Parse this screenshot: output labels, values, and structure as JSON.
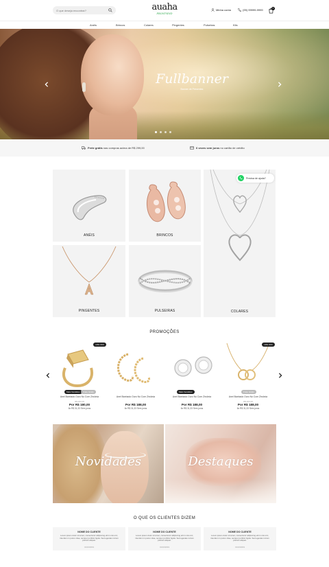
{
  "header": {
    "search_placeholder": "O que deseja encontrar?",
    "logo_main": "auaha",
    "logo_sub": "FRONT-END",
    "account_label": "Minha conta",
    "phone_label": "(99) 99999-9999",
    "cart_count": "0"
  },
  "nav": {
    "items": [
      {
        "label": "Anéis"
      },
      {
        "label": "Brincos"
      },
      {
        "label": "Colares"
      },
      {
        "label": "Pingentes"
      },
      {
        "label": "Pulseiras"
      },
      {
        "label": "Kits"
      }
    ]
  },
  "banner": {
    "title": "Fullbanner",
    "subtitle": "Banner de Presentes",
    "slides": 4,
    "active_slide": 1
  },
  "infobar": {
    "shipping_bold": "Frete grátis",
    "shipping_rest": "nas compras acima de R$ 299,00",
    "installments_bold": "6 vezes sem juros",
    "installments_rest": "no cartão de crédito"
  },
  "categories": [
    {
      "label": "ANÉIS"
    },
    {
      "label": "BRINCOS"
    },
    {
      "label": "PINGENTES"
    },
    {
      "label": "PULSEIRAS"
    },
    {
      "label": "COLARES"
    }
  ],
  "whatsapp": {
    "label": "Precisa de ajuda?"
  },
  "promotions": {
    "title": "PROMOÇÕES",
    "products": [
      {
        "off": "10% OFF",
        "tags": [
          "Mais Vendidos",
          "Frete Grátis"
        ],
        "name": "Anel Banhado Ouro Nó Com Zircônia",
        "old": "R$ 200,00",
        "price": "Por R$ 180,00",
        "installments": "6x R$ 31,33 Sem juros"
      },
      {
        "off": "",
        "tags": [],
        "name": "Anel Banhado Ouro Nó Com Zircônia",
        "old": "",
        "price": "Por R$ 188,00",
        "installments": "6x R$ 31,33 Sem juros"
      },
      {
        "off": "",
        "tags": [
          "Mais Vendidos"
        ],
        "name": "Anel Banhado Ouro Nó Com Zircônia",
        "old": "",
        "price": "Por R$ 188,00",
        "installments": "6x R$ 31,33 Sem juros"
      },
      {
        "off": "10% OFF",
        "tags": [
          "Frete Grátis"
        ],
        "name": "Anel Banhado Ouro Nó Com Zircônia",
        "old": "R$ 200,00",
        "price": "Por R$ 188,00",
        "installments": "6x R$ 31,33 Sem juros"
      }
    ]
  },
  "features": [
    {
      "label": "Novidades"
    },
    {
      "label": "Destaques"
    }
  ],
  "testimonials": {
    "title": "O QUE OS CLIENTES DIZEM",
    "cards": [
      {
        "name": "NOME DO CLIENTE",
        "body": "Lorem ipsum dolor sit amet, consectetur adipiscing elit in nisi orci, interdum in purus vitae, semper porttitor ligula. Sed egestas rutrum pretium aliquet.",
        "date": "31/10/2019"
      },
      {
        "name": "NOME DO CLIENTE",
        "body": "Lorem ipsum dolor sit amet, consectetur adipiscing elit in nisi orci, interdum in purus vitae, semper porttitor ligula. Sed egestas rutrum pretium aliquet.",
        "date": "31/10/2019"
      },
      {
        "name": "NOME DO CLIENTE",
        "body": "Lorem ipsum dolor sit amet, consectetur adipiscing elit in nisi orci, interdum in purus vitae, semper porttitor ligula. Sed egestas rutrum pretium aliquet.",
        "date": "31/10/2019"
      }
    ]
  }
}
